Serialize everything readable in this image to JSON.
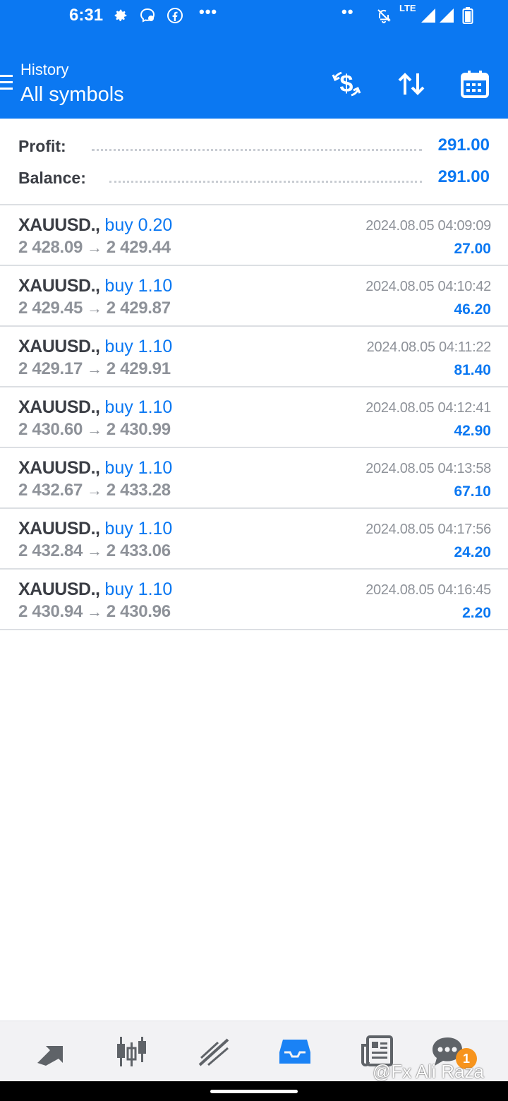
{
  "status_bar": {
    "time": "6:31",
    "network": "LTE",
    "icons": [
      "gear-icon",
      "messenger-icon",
      "facebook-icon",
      "more-dots-icon",
      "dual-dot-icon",
      "mute-bell-icon",
      "signal-icon",
      "signal-icon",
      "battery-icon"
    ]
  },
  "app_bar": {
    "title": "History",
    "subtitle": "All symbols",
    "actions": [
      "deposit-dollar-icon",
      "sort-icon",
      "calendar-icon"
    ]
  },
  "summary": {
    "profit_label": "Profit:",
    "profit_value": "291.00",
    "balance_label": "Balance:",
    "balance_value": "291.00"
  },
  "deals": [
    {
      "symbol": "XAUUSD.,",
      "type": "buy 0.20",
      "open": "2 428.09",
      "close": "2 429.44",
      "time": "2024.08.05 04:09:09",
      "profit": "27.00"
    },
    {
      "symbol": "XAUUSD.,",
      "type": "buy 1.10",
      "open": "2 429.45",
      "close": "2 429.87",
      "time": "2024.08.05 04:10:42",
      "profit": "46.20"
    },
    {
      "symbol": "XAUUSD.,",
      "type": "buy 1.10",
      "open": "2 429.17",
      "close": "2 429.91",
      "time": "2024.08.05 04:11:22",
      "profit": "81.40"
    },
    {
      "symbol": "XAUUSD.,",
      "type": "buy 1.10",
      "open": "2 430.60",
      "close": "2 430.99",
      "time": "2024.08.05 04:12:41",
      "profit": "42.90"
    },
    {
      "symbol": "XAUUSD.,",
      "type": "buy 1.10",
      "open": "2 432.67",
      "close": "2 433.28",
      "time": "2024.08.05 04:13:58",
      "profit": "67.10"
    },
    {
      "symbol": "XAUUSD.,",
      "type": "buy 1.10",
      "open": "2 432.84",
      "close": "2 433.06",
      "time": "2024.08.05 04:17:56",
      "profit": "24.20"
    },
    {
      "symbol": "XAUUSD.,",
      "type": "buy 1.10",
      "open": "2 430.94",
      "close": "2 430.96",
      "time": "2024.08.05 04:16:45",
      "profit": "2.20"
    }
  ],
  "arrow": "→",
  "bottom_nav": {
    "items": [
      "quotes-icon",
      "chart-candles-icon",
      "trade-icon",
      "history-inbox-icon",
      "news-icon",
      "messages-icon"
    ],
    "active": "history-inbox-icon",
    "badge": "1",
    "watermark": "@Fx Ali Raza"
  },
  "colors": {
    "accent": "#0b78f2",
    "text_dark": "#3a3d44",
    "text_gray": "#8e9299",
    "nav_inactive": "#5f6368",
    "badge": "#f7941d"
  }
}
